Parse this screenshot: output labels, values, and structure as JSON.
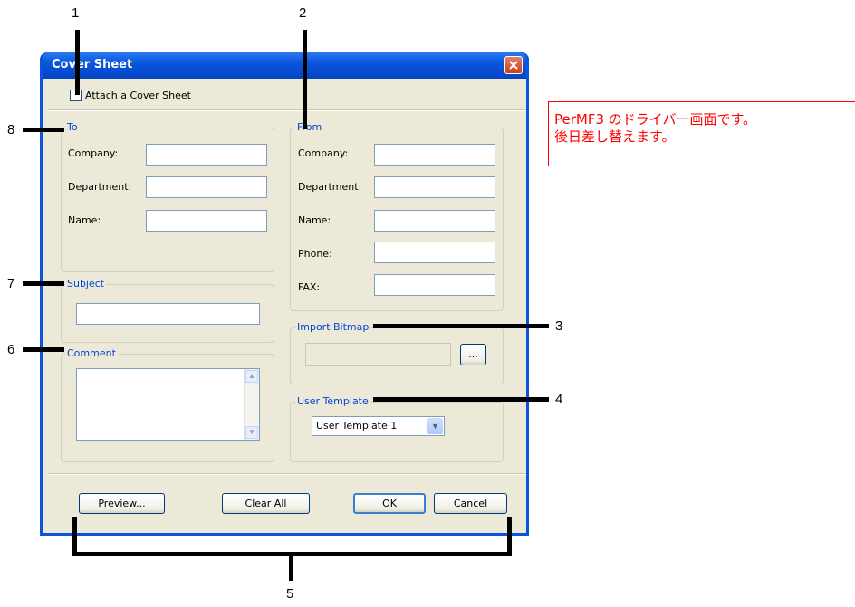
{
  "window": {
    "title": "Cover Sheet"
  },
  "attach": {
    "label": "Attach a Cover Sheet",
    "checked": false
  },
  "to": {
    "legend": "To",
    "company_label": "Company:",
    "department_label": "Department:",
    "name_label": "Name:"
  },
  "from": {
    "legend": "From",
    "company_label": "Company:",
    "department_label": "Department:",
    "name_label": "Name:",
    "phone_label": "Phone:",
    "fax_label": "FAX:"
  },
  "subject": {
    "legend": "Subject",
    "value": ""
  },
  "comment": {
    "legend": "Comment",
    "value": ""
  },
  "import_bitmap": {
    "legend": "Import Bitmap",
    "browse_label": "..."
  },
  "user_template": {
    "legend": "User Template",
    "selected": "User Template 1"
  },
  "buttons": {
    "preview": "Preview...",
    "clear_all": "Clear All",
    "ok": "OK",
    "cancel": "Cancel"
  },
  "callouts": {
    "c1": "1",
    "c2": "2",
    "c3": "3",
    "c4": "4",
    "c5": "5",
    "c6": "6",
    "c7": "7",
    "c8": "8"
  },
  "note": {
    "line1": "PerMF3 のドライバー画面です。",
    "line2": "後日差し替えます。"
  },
  "colors": {
    "titlebar": "#0a55dd",
    "dialog_bg": "#ece9d8",
    "group_legend": "#0046d5",
    "note": "#ff0000"
  }
}
